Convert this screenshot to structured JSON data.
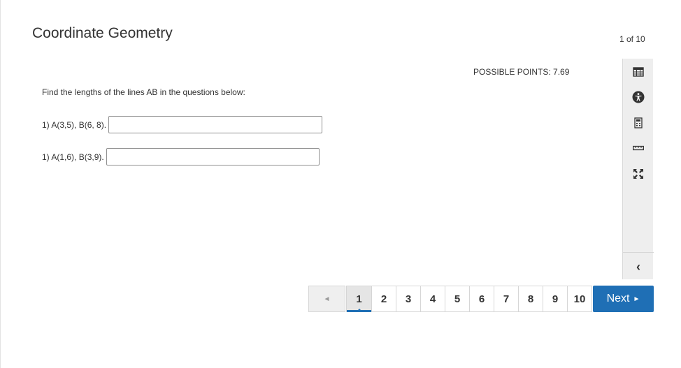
{
  "header": {
    "title": "Coordinate Geometry",
    "progress": "1 of 10"
  },
  "main": {
    "possible_points": "POSSIBLE POINTS: 7.69",
    "instructions": "Find the lengths of the lines AB in the questions below:",
    "questions": [
      {
        "label": "1) A(3,5), B(6, 8).",
        "value": ""
      },
      {
        "label": "1) A(1,6), B(3,9).",
        "value": ""
      }
    ]
  },
  "toolbar": {
    "tools": [
      "calendar-icon",
      "accessibility-icon",
      "calculator-icon",
      "ruler-icon",
      "fullscreen-icon"
    ],
    "collapse": "‹"
  },
  "pagination": {
    "prev": "◄",
    "pages": [
      "1",
      "2",
      "3",
      "4",
      "5",
      "6",
      "7",
      "8",
      "9",
      "10"
    ],
    "current": "1",
    "next_label": "Next",
    "next_arrow": "►"
  },
  "colors": {
    "accent": "#1f6fb5",
    "toolbar_bg": "#eeeeee"
  }
}
